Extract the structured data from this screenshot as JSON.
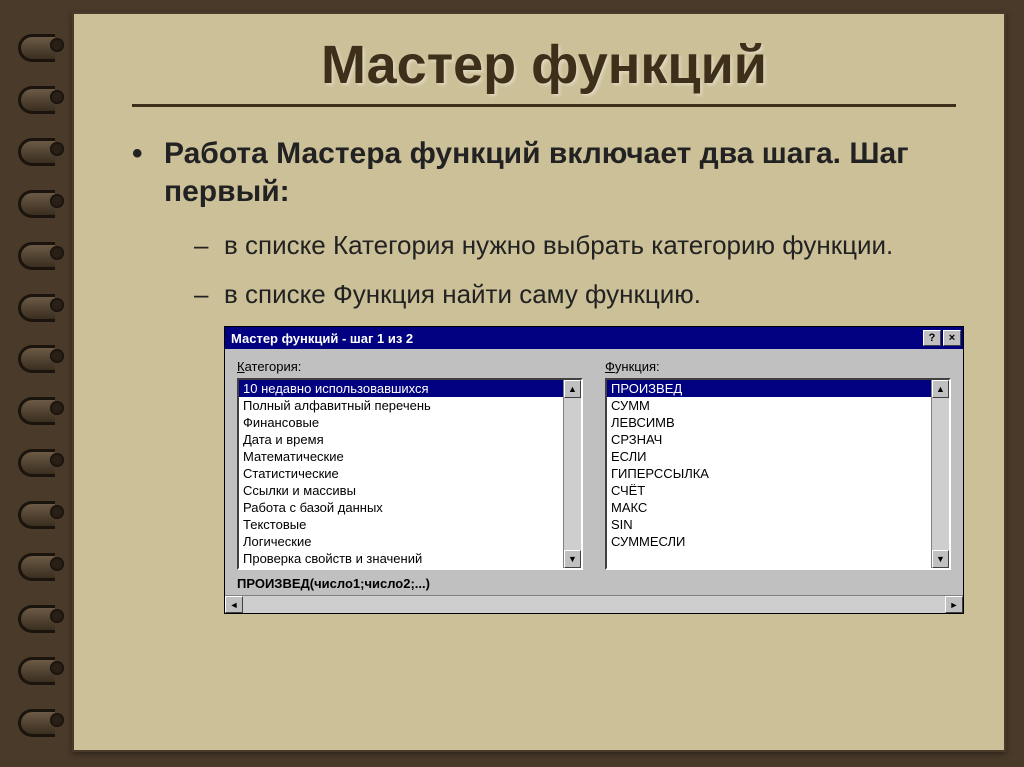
{
  "slide": {
    "title": "Мастер функций",
    "bullet_main": "Работа Мастера функций включает два шага. Шаг первый:",
    "bullet_sub1": "в списке Категория нужно выбрать категорию функции.",
    "bullet_sub2": "в списке Функция найти саму функцию."
  },
  "dialog": {
    "title": "Мастер функций - шаг 1 из 2",
    "help_btn": "?",
    "close_btn": "×",
    "category_label_pre": "К",
    "category_label_rest": "атегория:",
    "function_label_pre": "Ф",
    "function_label_rest": "ункция:",
    "categories": [
      "10 недавно использовавшихся",
      "Полный алфавитный перечень",
      "Финансовые",
      "Дата и время",
      "Математические",
      "Статистические",
      "Ссылки и массивы",
      "Работа с базой данных",
      "Текстовые",
      "Логические",
      "Проверка свойств и значений"
    ],
    "category_selected_index": 0,
    "functions": [
      "ПРОИЗВЕД",
      "СУММ",
      "ЛЕВСИМВ",
      "СРЗНАЧ",
      "ЕСЛИ",
      "ГИПЕРССЫЛКА",
      "СЧЁТ",
      "МАКС",
      "SIN",
      "СУММЕСЛИ"
    ],
    "function_selected_index": 0,
    "syntax_line": "ПРОИЗВЕД(число1;число2;...)",
    "scroll_up": "▲",
    "scroll_down": "▼",
    "scroll_left": "◄",
    "scroll_right": "►"
  }
}
